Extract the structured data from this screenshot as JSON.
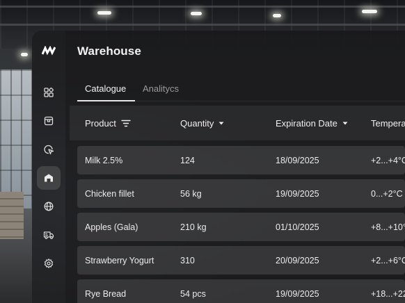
{
  "app": {
    "title": "Warehouse"
  },
  "sidebar": {
    "items": [
      {
        "icon": "dashboard-icon",
        "active": false
      },
      {
        "icon": "inventory-box-icon",
        "active": false
      },
      {
        "icon": "location-cursor-icon",
        "active": false
      },
      {
        "icon": "warehouse-icon",
        "active": true
      },
      {
        "icon": "globe-icon",
        "active": false
      },
      {
        "icon": "delivery-truck-icon",
        "active": false
      },
      {
        "icon": "settings-gear-icon",
        "active": false
      }
    ]
  },
  "tabs": [
    {
      "label": "Catalogue",
      "active": true
    },
    {
      "label": "Analitycs",
      "active": false
    }
  ],
  "table": {
    "columns": [
      {
        "label": "Product",
        "control": "filter-icon"
      },
      {
        "label": "Quantity",
        "control": "sort-caret-icon"
      },
      {
        "label": "Expiration Date",
        "control": "sort-caret-icon"
      },
      {
        "label": "Tempera"
      }
    ],
    "rows": [
      {
        "product": "Milk 2.5%",
        "quantity": "124",
        "expiration": "18/09/2025",
        "temperature": "+2...+4°C"
      },
      {
        "product": "Chicken fillet",
        "quantity": "56 kg",
        "expiration": "19/09/2025",
        "temperature": "0...+2°C"
      },
      {
        "product": "Apples (Gala)",
        "quantity": "210 kg",
        "expiration": "01/10/2025",
        "temperature": "+8...+10°"
      },
      {
        "product": "Strawberry Yogurt",
        "quantity": "310",
        "expiration": "20/09/2025",
        "temperature": "+2...+6°C"
      },
      {
        "product": "Rye Bread",
        "quantity": "54 pcs",
        "expiration": "19/09/2025",
        "temperature": "+18...+22"
      }
    ]
  },
  "colors": {
    "panel": "#1a1a1c",
    "row": "#5a5a5e",
    "accent": "#e8e8e8"
  }
}
